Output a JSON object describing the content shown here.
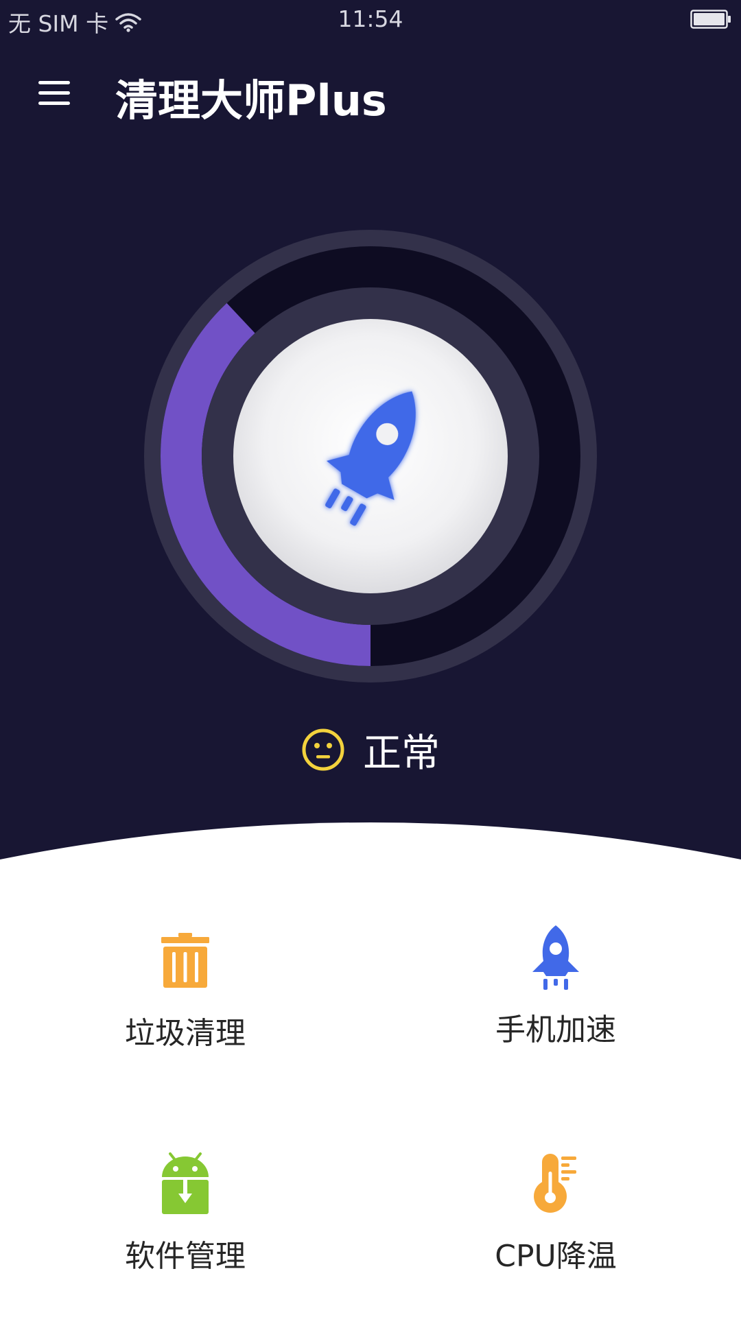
{
  "status_bar": {
    "carrier": "无 SIM 卡",
    "time": "11:54",
    "icons": [
      "wifi-icon",
      "battery-icon"
    ]
  },
  "app_bar": {
    "title": "清理大师Plus",
    "menu_icon": "menu-icon"
  },
  "gauge": {
    "usage_fraction": 0.38,
    "center_icon": "rocket-icon"
  },
  "status": {
    "icon": "neutral-face-icon",
    "label": "正常"
  },
  "features": [
    {
      "label": "垃圾清理",
      "icon": "trash-icon"
    },
    {
      "label": "手机加速",
      "icon": "rocket-icon"
    },
    {
      "label": "软件管理",
      "icon": "android-icon"
    },
    {
      "label": "CPU降温",
      "icon": "thermometer-icon"
    }
  ],
  "colors": {
    "background": "#181633",
    "gauge_fill": "#7151c6",
    "gauge_track": "#0e0c22",
    "rocket_blue": "#4169e8",
    "trash_orange": "#f7a93a",
    "android_green": "#86c833",
    "thermo_orange": "#f7a93a",
    "status_yellow": "#f3d23d"
  }
}
